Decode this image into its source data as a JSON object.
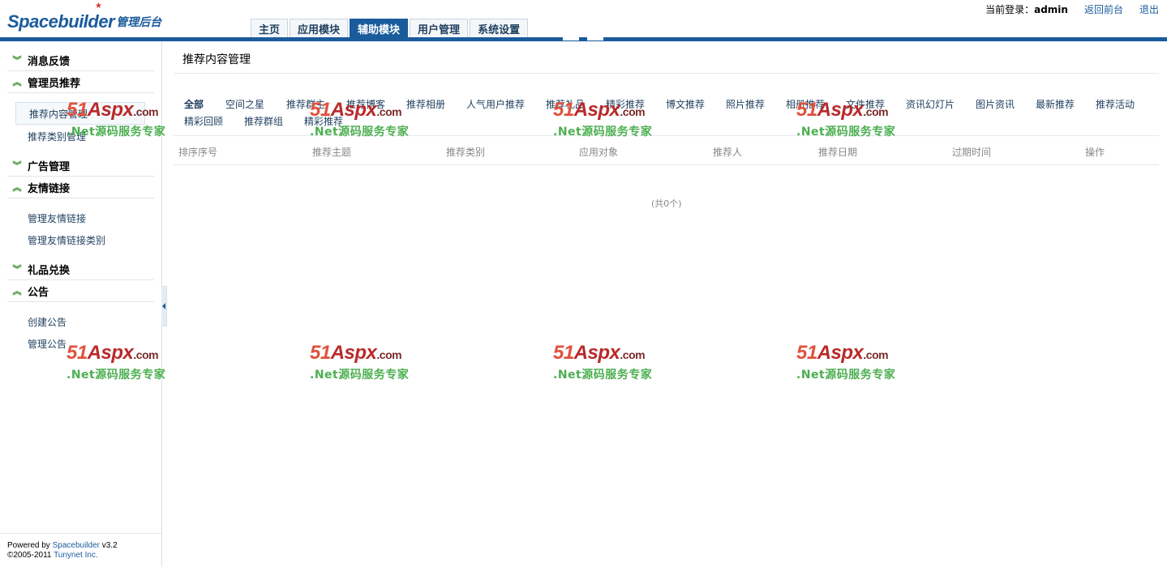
{
  "brand": {
    "logo_main": "Spacebuilder",
    "logo_sub": "管理后台"
  },
  "top_links": {
    "user_prefix": "当前登录：",
    "user_name": "admin",
    "back_front": "返回前台",
    "logout": "退出"
  },
  "nav": {
    "tabs": [
      {
        "label": "主页"
      },
      {
        "label": "应用模块"
      },
      {
        "label": "辅助模块"
      },
      {
        "label": "用户管理"
      },
      {
        "label": "系统设置"
      }
    ],
    "active_index": 2
  },
  "sidebar": {
    "sections": [
      {
        "label": "消息反馈",
        "expanded": false
      },
      {
        "label": "管理员推荐",
        "expanded": true,
        "items": [
          "推荐内容管理",
          "推荐类别管理"
        ]
      },
      {
        "label": "广告管理",
        "expanded": false
      },
      {
        "label": "友情链接",
        "expanded": true,
        "items": [
          "管理友情链接",
          "管理友情链接类别"
        ]
      },
      {
        "label": "礼品兑换",
        "expanded": false
      },
      {
        "label": "公告",
        "expanded": true,
        "items": [
          "创建公告",
          "管理公告"
        ]
      }
    ],
    "footer": {
      "powered_by": "Powered by",
      "product": "Spacebuilder",
      "version": "v3.2",
      "copyright": "©2005-2011",
      "company": "Tunynet Inc."
    }
  },
  "main": {
    "title": "推荐内容管理",
    "filters": [
      "全部",
      "空间之星",
      "推荐群主",
      "推荐博客",
      "推荐相册",
      "人气用户推荐",
      "推荐礼品",
      "精彩推荐",
      "博文推荐",
      "照片推荐",
      "相册推荐",
      "文件推荐",
      "资讯幻灯片",
      "图片资讯",
      "最新推荐",
      "推荐活动",
      "精彩回顾",
      "推荐群组",
      "精彩推荐"
    ],
    "active_filter": 0,
    "columns": [
      "排序序号",
      "推荐主题",
      "推荐类别",
      "应用对象",
      "推荐人",
      "推荐日期",
      "过期时间",
      "操作"
    ],
    "empty_text": "(共0个)"
  },
  "watermark": {
    "line1_num": "51",
    "line1_word": "Aspx",
    "line1_tld": ".com",
    "line2": ".Net源码服务专家"
  },
  "colors": {
    "brand_blue": "#1a5b9c",
    "chevron_green": "#3a8a2a",
    "watermark_red": "#b82a2a",
    "watermark_green": "#4caf50"
  },
  "icons": {
    "collapsed": "chevron-double-down-icon",
    "expanded": "chevron-double-up-icon",
    "sidebar_toggle": "triangle-left-icon"
  }
}
